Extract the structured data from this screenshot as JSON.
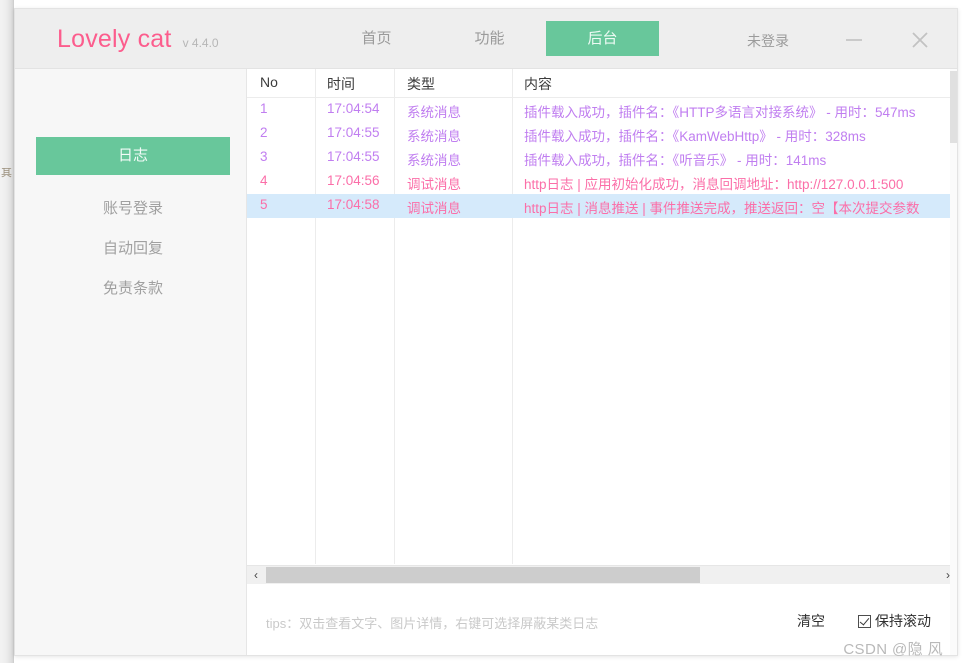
{
  "window": {
    "brand_name": "Lovely cat",
    "version_label": "v 4.4.0",
    "login_status": "未登录",
    "minimize_icon": "minimize-icon",
    "close_icon": "close-icon"
  },
  "nav": {
    "tabs": [
      {
        "label": "首页",
        "active": false
      },
      {
        "label": "功能",
        "active": false
      },
      {
        "label": "后台",
        "active": true
      }
    ]
  },
  "sidebar": {
    "items": [
      {
        "label": "日志",
        "active": true
      },
      {
        "label": "账号登录",
        "active": false
      },
      {
        "label": "自动回复",
        "active": false
      },
      {
        "label": "免责条款",
        "active": false
      }
    ]
  },
  "log_table": {
    "columns": [
      "No",
      "时间",
      "类型",
      "内容"
    ],
    "rows": [
      {
        "no": "1",
        "time": "17:04:54",
        "type": "系统消息",
        "content": "插件载入成功，插件名：《HTTP多语言对接系统》 - 用时：547ms",
        "kind": "system",
        "selected": false
      },
      {
        "no": "2",
        "time": "17:04:55",
        "type": "系统消息",
        "content": "插件载入成功，插件名：《KamWebHttp》 - 用时：328ms",
        "kind": "system",
        "selected": false
      },
      {
        "no": "3",
        "time": "17:04:55",
        "type": "系统消息",
        "content": "插件载入成功，插件名：《听音乐》 - 用时：141ms",
        "kind": "system",
        "selected": false
      },
      {
        "no": "4",
        "time": "17:04:56",
        "type": "调试消息",
        "content": "http日志 | 应用初始化成功，消息回调地址：http://127.0.0.1:500",
        "kind": "debug",
        "selected": false
      },
      {
        "no": "5",
        "time": "17:04:58",
        "type": "调试消息",
        "content": "http日志 | 消息推送 | 事件推送完成，推送返回：空【本次提交参数",
        "kind": "debug",
        "selected": true
      }
    ]
  },
  "scrollbars": {
    "h_left_arrow": "‹",
    "h_right_arrow": "›"
  },
  "footer": {
    "tips": "tips：双击查看文字、图片详情，右键可选择屏蔽某类日志",
    "clear_label": "清空",
    "keep_scroll_label": "保持滚动",
    "keep_scroll_checked": true
  },
  "watermark": "CSDN @隐 风",
  "background_sliver_text": "其",
  "colors": {
    "accent_green": "#68c79b",
    "brand_pink": "#fc5d8d",
    "system_message": "#c07ef0",
    "debug_message": "#fb6ea8",
    "selected_row": "#d5eafb"
  }
}
